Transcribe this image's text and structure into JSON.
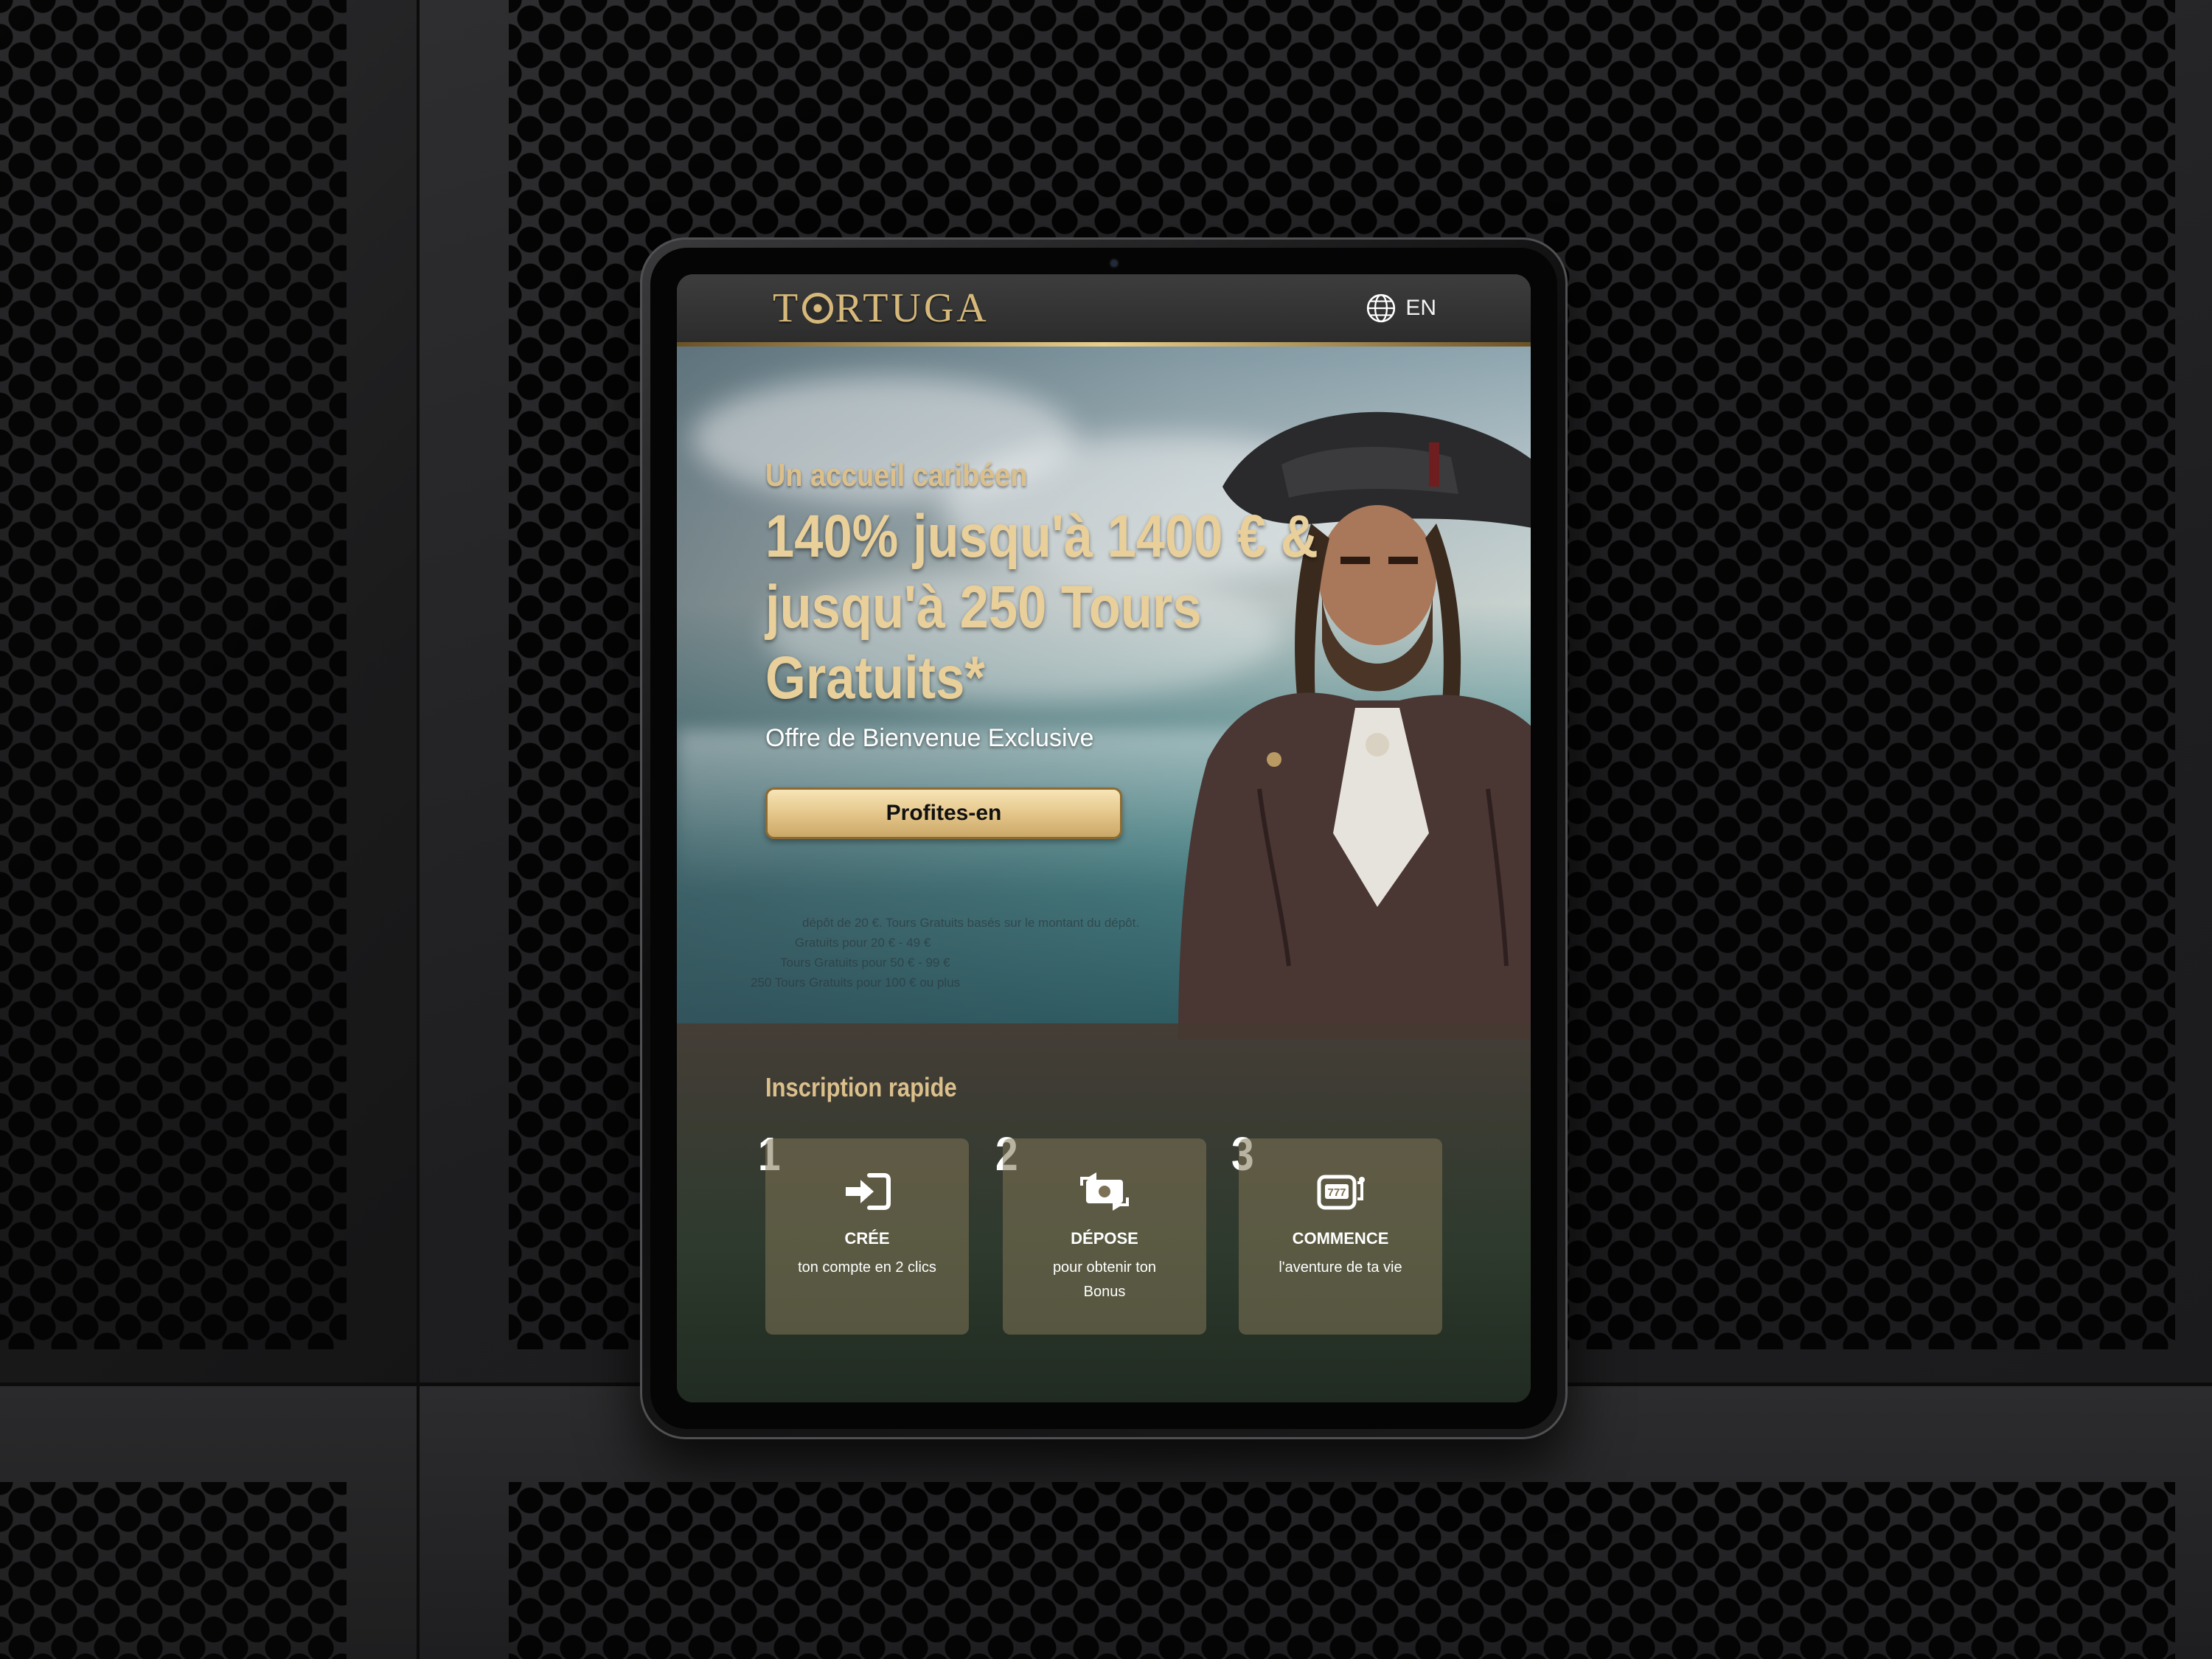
{
  "site": {
    "logo_text_left": "T",
    "logo_text_right": "RTUGA",
    "language": "EN"
  },
  "hero": {
    "subtitle": "Un accueil caribéen",
    "headline": "140% jusqu'à 1400 € & jusqu'à 250 Tours Gratuits*",
    "offer": "Offre de Bienvenue Exclusive",
    "cta_label": "Profites-en",
    "terms": [
      "dépôt de 20 €. Tours Gratuits basés sur le montant du dépôt.",
      "Gratuits pour 20 € - 49 €",
      "Tours Gratuits pour 50 € - 99 €",
      "250 Tours Gratuits pour 100 € ou plus"
    ]
  },
  "signup": {
    "title": "Inscription rapide",
    "steps": [
      {
        "number": "1",
        "icon": "sign-in-icon",
        "title": "CRÉE",
        "desc": "ton compte en 2 clics"
      },
      {
        "number": "2",
        "icon": "money-exchange-icon",
        "title": "DÉPOSE",
        "desc": "pour obtenir ton Bonus"
      },
      {
        "number": "3",
        "icon": "slot-machine-777-icon",
        "title": "COMMENCE",
        "desc": "l'aventure de ta vie"
      }
    ]
  },
  "colors": {
    "gold": "#dcc08c",
    "gold_light": "#e9cf9a",
    "header_bg": "#2c2c2c",
    "metal_bg": "#202021"
  }
}
